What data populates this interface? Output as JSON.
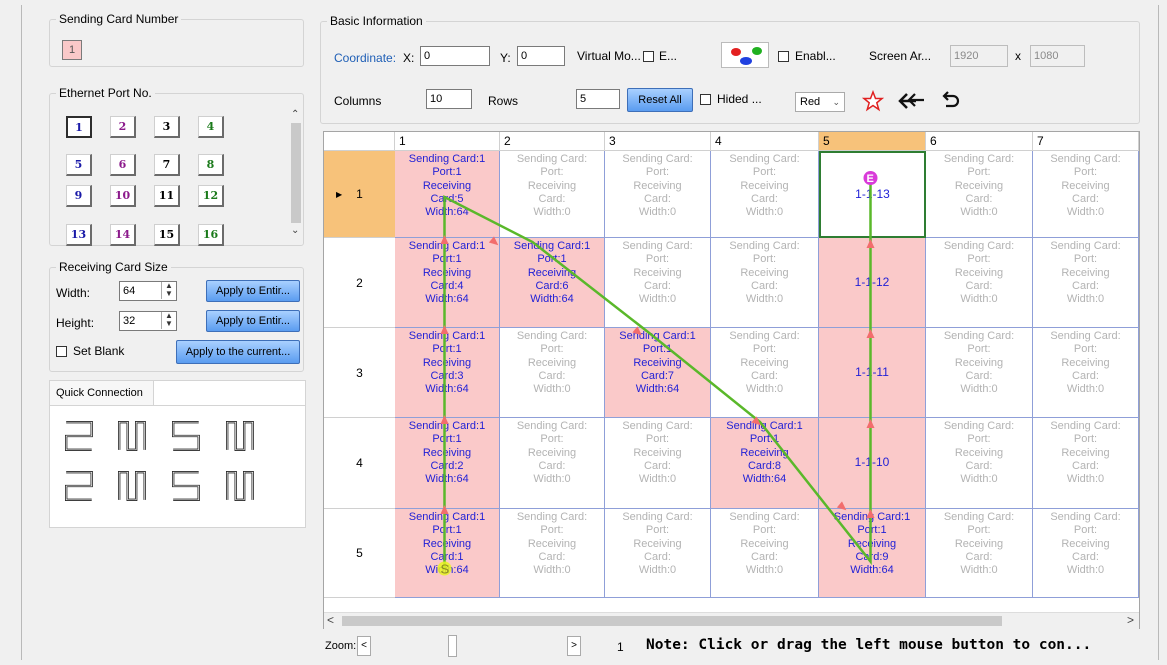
{
  "sending_card": {
    "legend": "Sending Card Number",
    "value": "1"
  },
  "ethernet": {
    "legend": "Ethernet Port No.",
    "ports": [
      {
        "label": "1",
        "color": "#1a1aa8"
      },
      {
        "label": "2",
        "color": "#8c1a8c"
      },
      {
        "label": "3",
        "color": "#000000"
      },
      {
        "label": "4",
        "color": "#1a7a1a"
      },
      {
        "label": "5",
        "color": "#1a1aa8"
      },
      {
        "label": "6",
        "color": "#8c1a8c"
      },
      {
        "label": "7",
        "color": "#000000"
      },
      {
        "label": "8",
        "color": "#1a7a1a"
      },
      {
        "label": "9",
        "color": "#1a1aa8"
      },
      {
        "label": "10",
        "color": "#8c1a8c"
      },
      {
        "label": "11",
        "color": "#000000"
      },
      {
        "label": "12",
        "color": "#1a7a1a"
      },
      {
        "label": "13",
        "color": "#1a1aa8"
      },
      {
        "label": "14",
        "color": "#8c1a8c"
      },
      {
        "label": "15",
        "color": "#000000"
      },
      {
        "label": "16",
        "color": "#1a7a1a"
      }
    ]
  },
  "receiving_size": {
    "legend": "Receiving Card Size",
    "width_label": "Width:",
    "width_value": "64",
    "height_label": "Height:",
    "height_value": "32",
    "apply_label": "Apply to Entir...",
    "apply_label2": "Apply to Entir...",
    "set_blank_label": "Set Blank",
    "apply_current_label": "Apply to the current..."
  },
  "quick_connection": {
    "legend": "Quick Connection"
  },
  "basic": {
    "legend": "Basic Information",
    "coordinate_label": "Coordinate:",
    "x_label": "X:",
    "x_value": "0",
    "y_label": "Y:",
    "y_value": "0",
    "virtual_label": "Virtual Mo...",
    "e_label": "E...",
    "enable_label": "Enabl...",
    "screen_area_label": "Screen Ar...",
    "screen_w": "1920",
    "times": "x",
    "screen_h": "1080",
    "columns_label": "Columns",
    "columns_value": "10",
    "rows_label": "Rows",
    "rows_value": "5",
    "reset_label": "Reset All",
    "hided_label": "Hided ...",
    "color_select": "Red"
  },
  "grid": {
    "col_headers": [
      "1",
      "2",
      "3",
      "4",
      "5",
      "6",
      "7"
    ],
    "row_headers": [
      "1",
      "2",
      "3",
      "4",
      "5"
    ],
    "inactive_lines": [
      "Sending Card:",
      "Port:",
      "Receiving",
      "Card:",
      "Width:0"
    ],
    "column1": [
      [
        "Sending Card:1",
        "Port:1",
        "Receiving",
        "Card:5",
        "Width:64"
      ],
      [
        "Sending Card:1",
        "Port:1",
        "Receiving",
        "Card:4",
        "Width:64"
      ],
      [
        "Sending Card:1",
        "Port:1",
        "Receiving",
        "Card:3",
        "Width:64"
      ],
      [
        "Sending Card:1",
        "Port:1",
        "Receiving",
        "Card:2",
        "Width:64"
      ],
      [
        "Sending Card:1",
        "Port:1",
        "Receiving",
        "Card:1",
        "Width:64"
      ]
    ],
    "diagonal": [
      [
        "Sending Card:1",
        "Port:1",
        "Receiving",
        "Card:6",
        "Width:64"
      ],
      [
        "Sending Card:1",
        "Port:1",
        "Receiving",
        "Card:7",
        "Width:64"
      ],
      [
        "Sending Card:1",
        "Port:1",
        "Receiving",
        "Card:8",
        "Width:64"
      ],
      [
        "Sending Card:1",
        "Port:1",
        "Receiving",
        "Card:9",
        "Width:64"
      ]
    ],
    "column5_short": [
      "1-1-13",
      "1-1-12",
      "1-1-11",
      "1-1-10"
    ],
    "start_marker": "S",
    "end_marker": "E"
  },
  "footer": {
    "zoom_label": "Zoom:",
    "zoom_value": "1",
    "note": "Note: Click or drag the left mouse button to con..."
  },
  "colors": {
    "active_cell": "#fac9c9",
    "line": "#5ab82a",
    "arrow": "#f26d6d",
    "selected_header": "#f7c27a",
    "cell_text_active": "#1f1fd6"
  }
}
